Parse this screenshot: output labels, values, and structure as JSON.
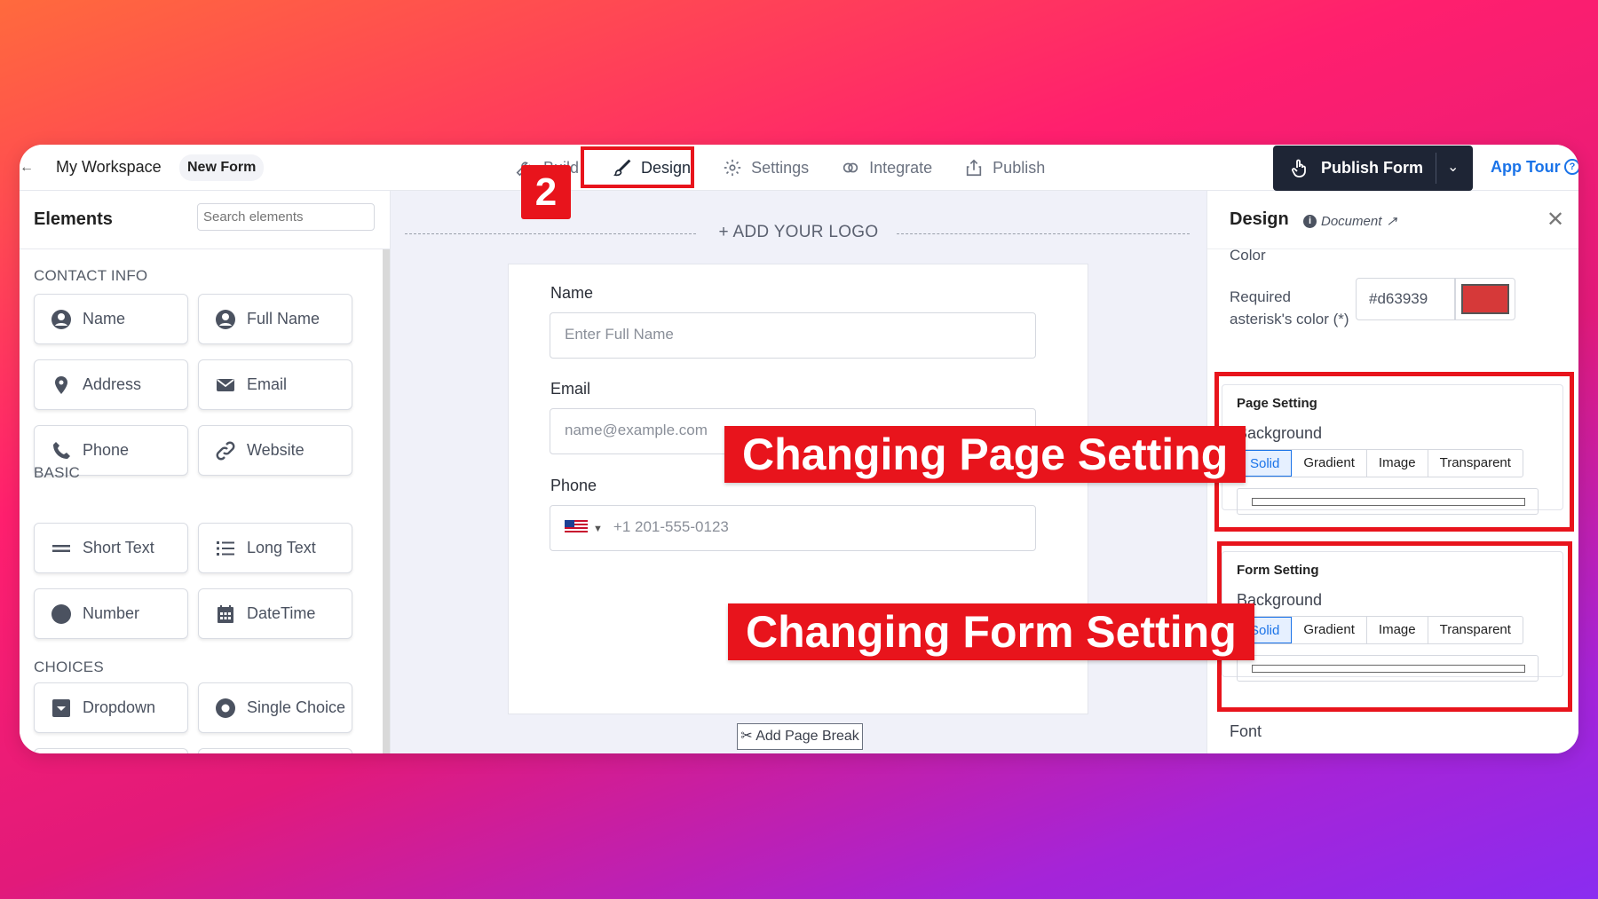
{
  "topbar": {
    "workspace": "My Workspace",
    "form_name": "New Form",
    "nav": [
      {
        "label": "Build"
      },
      {
        "label": "Design"
      },
      {
        "label": "Settings"
      },
      {
        "label": "Integrate"
      },
      {
        "label": "Publish"
      }
    ],
    "publish_button": "Publish Form",
    "app_tour": "App Tour",
    "step_badge": "2"
  },
  "sidebar": {
    "title": "Elements",
    "search_placeholder": "Search elements",
    "sections": {
      "contact": "CONTACT INFO",
      "basic": "BASIC",
      "choices": "CHOICES"
    },
    "contact_items": [
      "Name",
      "Full Name",
      "Address",
      "Email",
      "Phone",
      "Website"
    ],
    "basic_items": [
      "Short Text",
      "Long Text",
      "Number",
      "DateTime"
    ],
    "choice_items": [
      "Dropdown",
      "Single Choice"
    ]
  },
  "canvas": {
    "logo": "+ ADD YOUR LOGO",
    "fields": [
      {
        "label": "Name",
        "placeholder": "Enter Full Name"
      },
      {
        "label": "Email",
        "placeholder": "name@example.com"
      },
      {
        "label": "Phone",
        "placeholder": "+1 201-555-0123"
      }
    ],
    "page_break": "Add Page Break"
  },
  "callouts": {
    "page": "Changing Page Setting",
    "form": "Changing Form Setting"
  },
  "design_panel": {
    "title": "Design",
    "doc_link": "Document",
    "color_label": "Color",
    "asterisk_label": "Required asterisk's color (*)",
    "asterisk_hex": "#d63939",
    "asterisk_color": "#d63939",
    "page_setting": {
      "title": "Page Setting",
      "background": "Background",
      "options": [
        "Solid",
        "Gradient",
        "Image",
        "Transparent"
      ],
      "selected": "Solid"
    },
    "form_setting": {
      "title": "Form Setting",
      "background": "Background",
      "options": [
        "Solid",
        "Gradient",
        "Image",
        "Transparent"
      ],
      "selected": "Solid"
    },
    "font_label": "Font"
  },
  "colors": {
    "annotation_red": "#e8141c",
    "primary_blue": "#1a73e8",
    "publish_dark": "#1e2535"
  }
}
